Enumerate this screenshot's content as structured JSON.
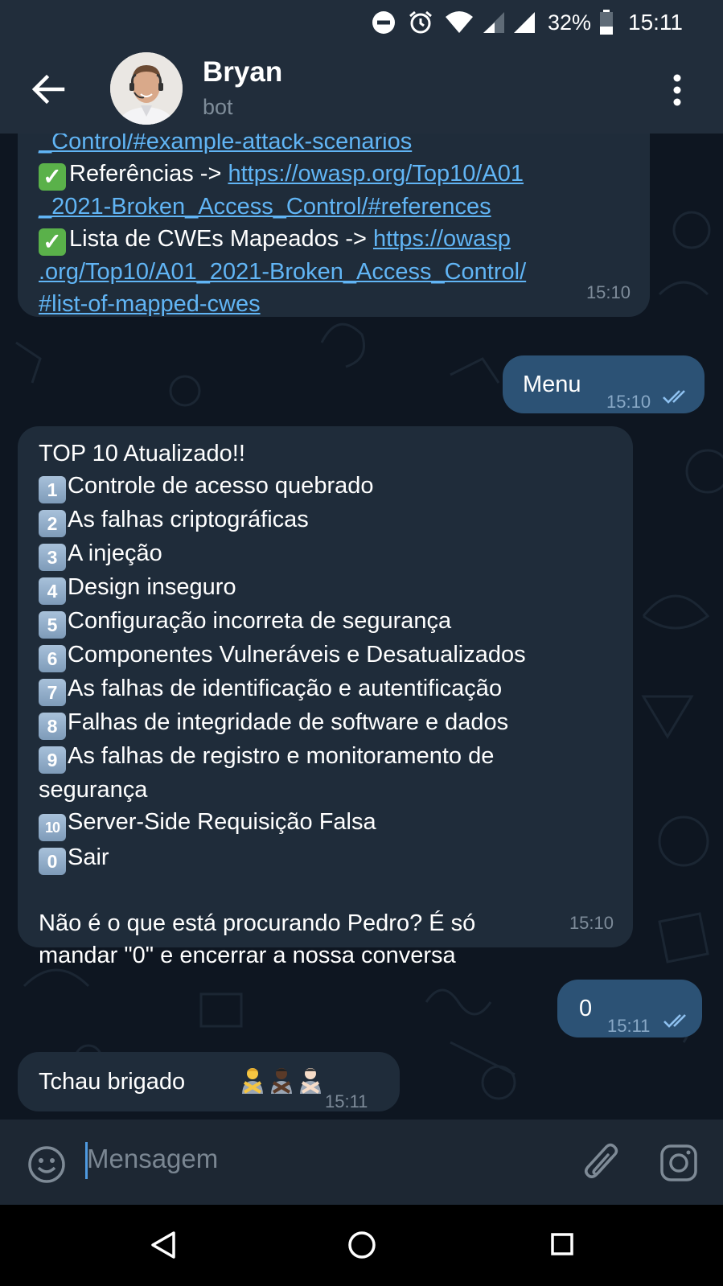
{
  "status_bar": {
    "battery_percent": "32%",
    "time": "15:11"
  },
  "header": {
    "name": "Bryan",
    "subtitle": "bot"
  },
  "messages": [
    {
      "lines": [
        {
          "type": "link",
          "text": "_Control/#example-attack-scenarios"
        },
        {
          "type": "mixed",
          "prefix": "Referências -> ",
          "link": "https://owasp.org/Top10/A01"
        },
        {
          "type": "link",
          "text": "_2021-Broken_Access_Control/#references"
        },
        {
          "type": "mixed",
          "prefix": "Lista de CWEs Mapeados -> ",
          "link": "https://owasp"
        },
        {
          "type": "link",
          "text": ".org/Top10/A01_2021-Broken_Access_Control/"
        },
        {
          "type": "link",
          "text": "#list-of-mapped-cwes"
        }
      ],
      "time": "15:10"
    },
    {
      "text": "Menu",
      "time": "15:10"
    },
    {
      "title": "TOP 10 Atualizado!!",
      "items": [
        {
          "n": "1",
          "text": "Controle de acesso quebrado"
        },
        {
          "n": "2",
          "text": "As falhas criptográficas"
        },
        {
          "n": "3",
          "text": "A injeção"
        },
        {
          "n": "4",
          "text": "Design inseguro"
        },
        {
          "n": "5",
          "text": "Configuração incorreta de segurança"
        },
        {
          "n": "6",
          "text": "Componentes Vulneráveis e Desatualizados"
        },
        {
          "n": "7",
          "text": "As falhas de identificação e autentificação"
        },
        {
          "n": "8",
          "text": "Falhas de integridade de software e dados"
        },
        {
          "n": "9",
          "text": "As falhas de registro e monitoramento de"
        },
        {
          "n": "",
          "text": "segurança"
        },
        {
          "n": "10",
          "text": "Server-Side Requisição Falsa"
        },
        {
          "n": "0",
          "text": "Sair"
        }
      ],
      "footer_line1": "Não é o que está procurando Pedro? É só",
      "footer_line2": "mandar \"0\" e encerrar a nossa conversa",
      "time": "15:10"
    },
    {
      "text": "0",
      "time": "15:11"
    },
    {
      "text": "Tchau brigado",
      "time": "15:11"
    }
  ],
  "input": {
    "placeholder": "Mensagem"
  }
}
